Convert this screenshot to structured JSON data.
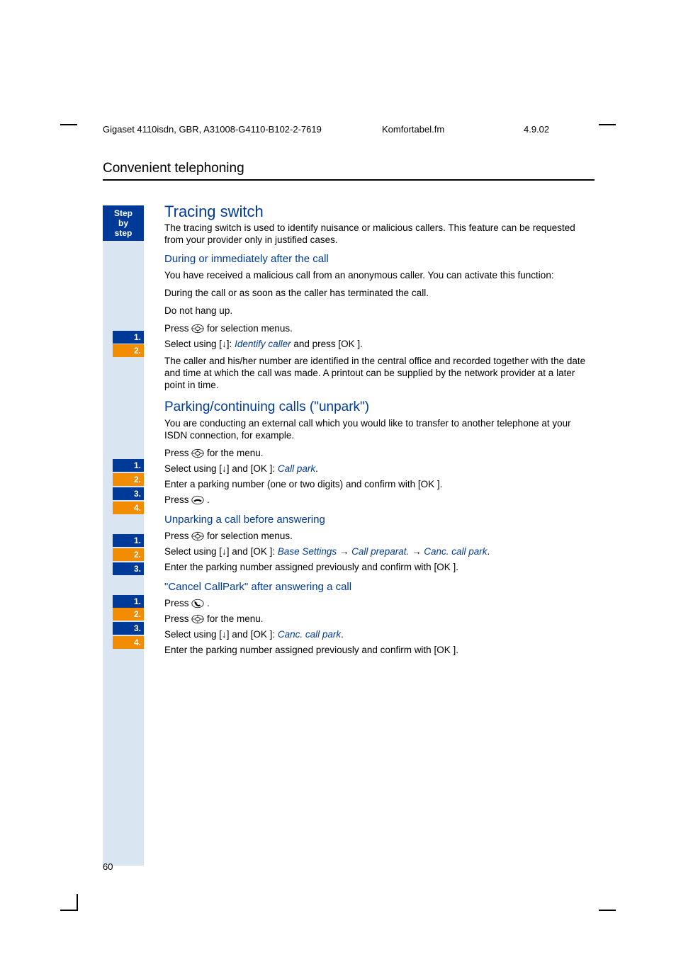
{
  "header": {
    "left": "Gigaset 4110isdn, GBR, A31008-G4110-B102-2-7619",
    "mid": "Komfortabel.fm",
    "right": "4.9.02"
  },
  "section_title": "Convenient telephoning",
  "sidebar": {
    "step_lines": [
      "Step",
      "by",
      "step"
    ]
  },
  "tracing": {
    "title": "Tracing switch",
    "intro": "The tracing switch is used to identify nuisance or malicious callers. This feature can be requested from your provider only in justified cases.",
    "sub1_title": "During or immediately after the call",
    "sub1_p1": "You have received a malicious call from an anonymous caller. You can activate this function:",
    "sub1_p2": "During the call or as soon as the caller has terminated the call.",
    "sub1_p3": "Do not hang up.",
    "step1_pre": "Press ",
    "step1_post": " for selection menus.",
    "step2_pre": "Select using [",
    "step2_mid": "]: ",
    "step2_ital": "Identify caller",
    "step2_post": " and press [OK ].",
    "tail": "The caller and his/her number are identified in the central office and recorded together with the date and time at which the call was made. A printout can be supplied by the network provider at a later point in time."
  },
  "parking": {
    "title": "Parking/continuing calls (\"unpark\")",
    "intro": "You are conducting an external call which you would like to transfer to another telephone at your ISDN connection, for example.",
    "s1_pre": "Press ",
    "s1_post": " for the menu.",
    "s2_pre": "Select using [",
    "s2_mid": "] and [OK ]: ",
    "s2_ital": "Call park",
    "s2_post": ".",
    "s3": "Enter a parking number (one or two digits) and confirm with [OK ].",
    "s4_pre": "Press ",
    "s4_post": " ."
  },
  "unpark": {
    "title": "Unparking a call before answering",
    "s1_pre": "Press ",
    "s1_post": " for selection menus.",
    "s2_pre": "Select using [",
    "s2_mid": "] and [OK ]: ",
    "s2_i1": "Base Settings",
    "s2_arrow1": " → ",
    "s2_i2": "Call preparat.",
    "s2_arrow2": " → ",
    "s2_i3": "Canc. call park",
    "s2_post": ".",
    "s3": "Enter the parking number assigned previously and confirm with [OK ]."
  },
  "cancel": {
    "title": "\"Cancel CallPark\" after answering a call",
    "s1_pre": "Press ",
    "s1_post": " .",
    "s2_pre": "Press ",
    "s2_post": " for the menu.",
    "s3_pre": "Select using [",
    "s3_mid": "] and [OK ]: ",
    "s3_ital": "Canc. call park",
    "s3_post": ".",
    "s4": "Enter the parking number assigned previously and confirm with [OK ]."
  },
  "arrow_down": "↓",
  "page_number": "60",
  "badges": {
    "tracing": [
      "1.",
      "2."
    ],
    "parking": [
      "1.",
      "2.",
      "3.",
      "4."
    ],
    "unpark": [
      "1.",
      "2.",
      "3."
    ],
    "cancel": [
      "1.",
      "2.",
      "3.",
      "4."
    ]
  }
}
